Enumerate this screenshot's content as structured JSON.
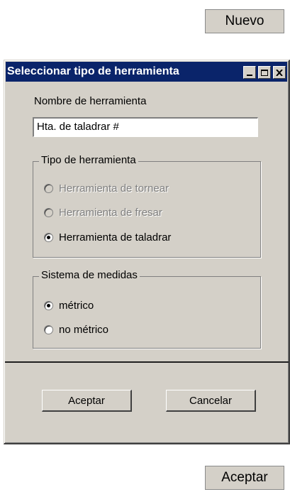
{
  "top_button": {
    "label": "Nuevo"
  },
  "dialog": {
    "title": "Seleccionar tipo de herramienta",
    "name_label": "Nombre de herramienta",
    "name_value": "Hta. de taladrar #",
    "tool_type": {
      "legend": "Tipo de herramienta",
      "options": [
        {
          "label": "Herramienta de tornear",
          "selected": false,
          "enabled": false
        },
        {
          "label": "Herramienta de fresar",
          "selected": false,
          "enabled": false
        },
        {
          "label": "Herramienta de taladrar",
          "selected": true,
          "enabled": true
        }
      ]
    },
    "measure_system": {
      "legend": "Sistema de medidas",
      "options": [
        {
          "label": "métrico",
          "selected": true,
          "enabled": true
        },
        {
          "label": "no métrico",
          "selected": false,
          "enabled": true
        }
      ]
    },
    "accept_label": "Aceptar",
    "cancel_label": "Cancelar"
  },
  "bottom_button": {
    "label": "Aceptar"
  },
  "colors": {
    "title_bg": "#0a246a",
    "dialog_bg": "#d4d0c8"
  }
}
